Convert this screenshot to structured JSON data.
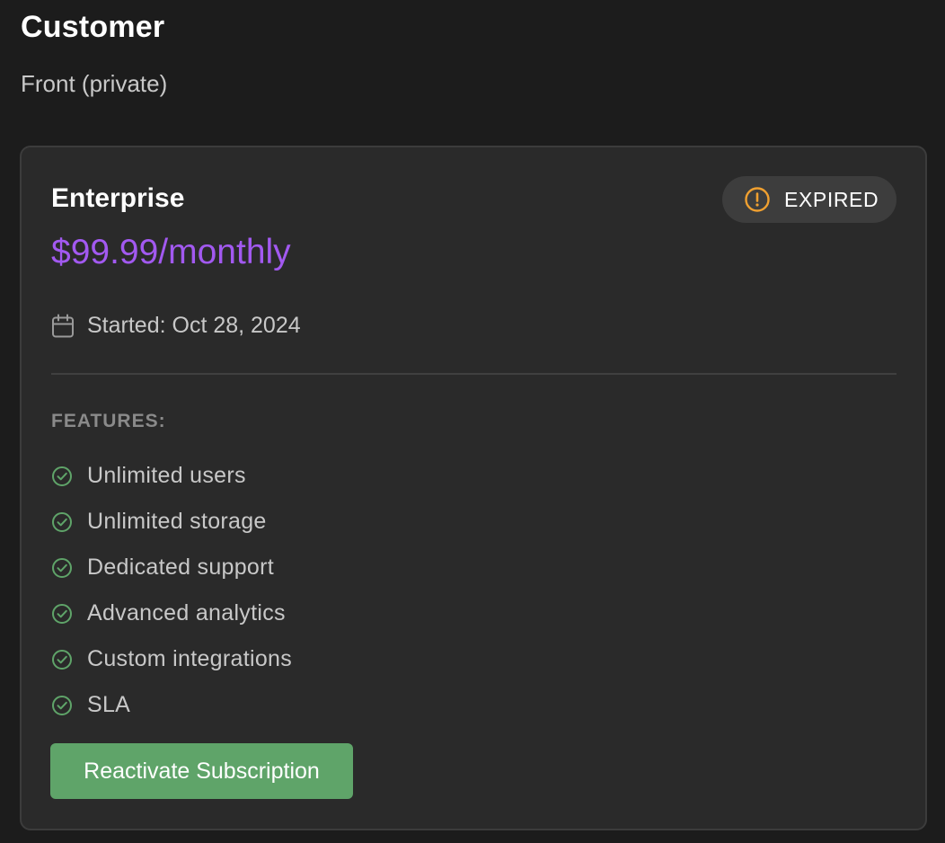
{
  "header": {
    "title": "Customer",
    "subtitle": "Front (private)"
  },
  "subscription": {
    "plan_name": "Enterprise",
    "price": "$99.99/monthly",
    "status": "EXPIRED",
    "status_icon": "alert-circle-icon",
    "started": "Started: Oct 28, 2024",
    "features_heading": "FEATURES:",
    "features": [
      "Unlimited users",
      "Unlimited storage",
      "Dedicated support",
      "Advanced analytics",
      "Custom integrations",
      "SLA"
    ],
    "button_label": "Reactivate Subscription"
  },
  "colors": {
    "background": "#1c1c1c",
    "card": "#2a2a2a",
    "price": "#a259f0",
    "status_warning": "#f0a030",
    "check": "#5fa469",
    "button": "#5fa469"
  }
}
